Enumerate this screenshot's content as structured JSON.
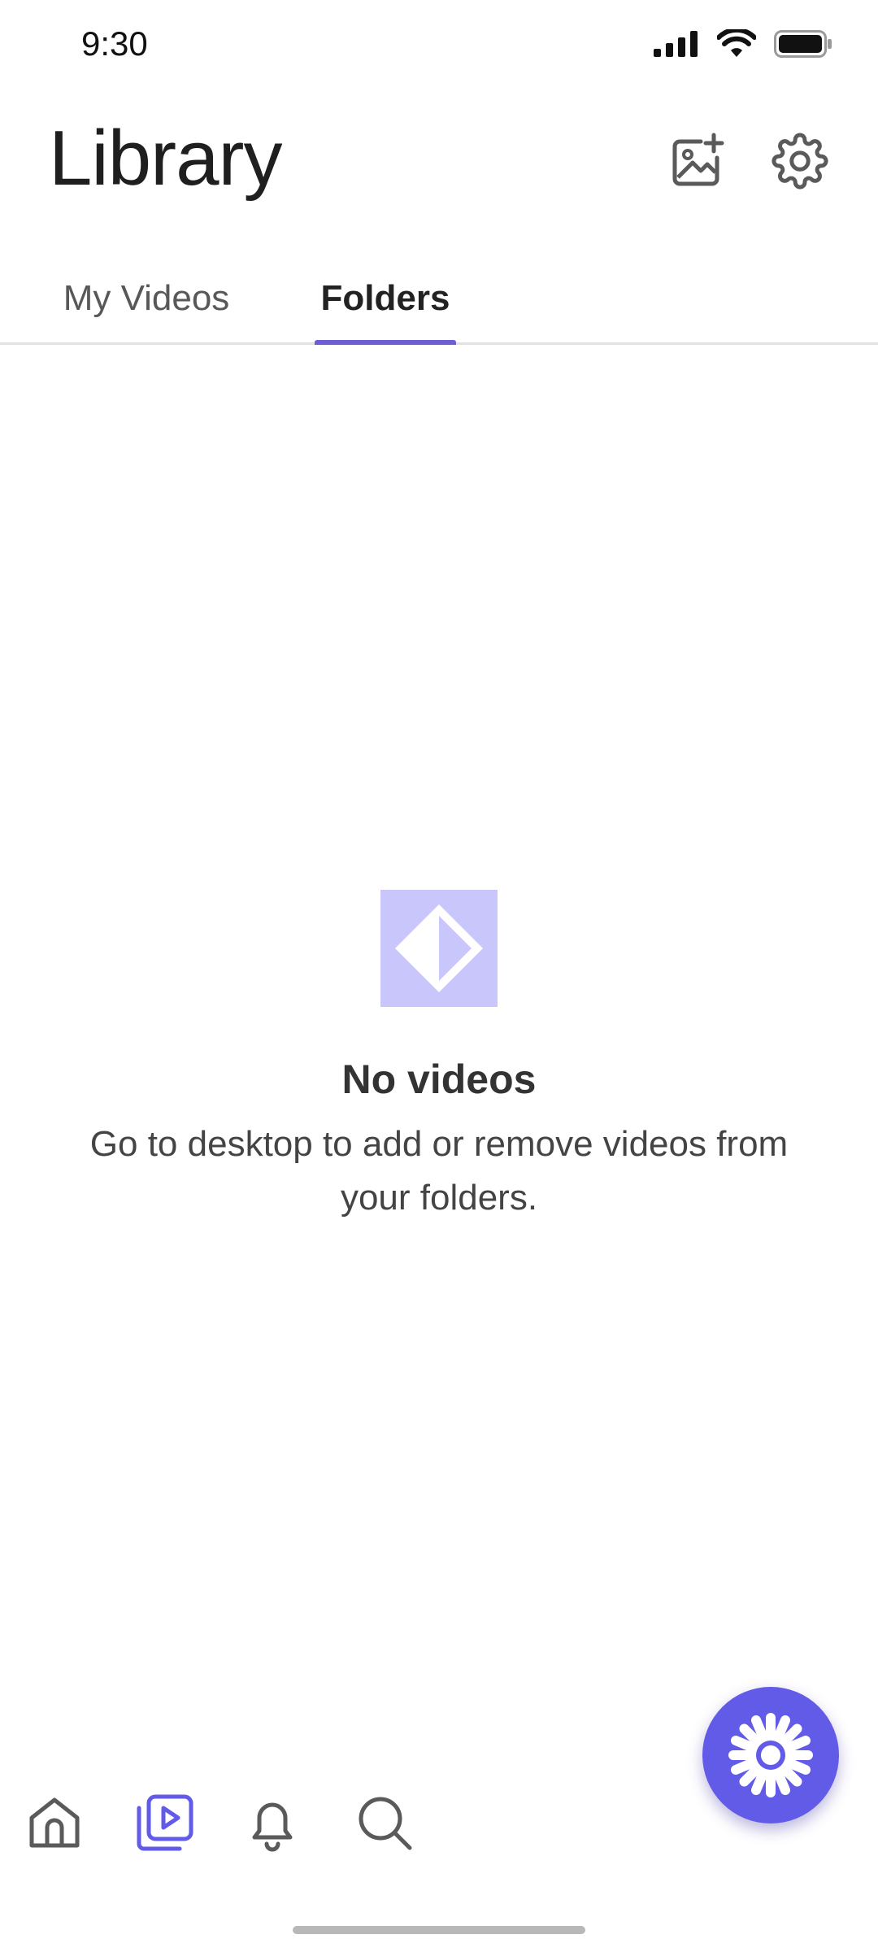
{
  "status_bar": {
    "time": "9:30"
  },
  "header": {
    "title": "Library"
  },
  "tabs": [
    {
      "label": "My Videos",
      "active": false
    },
    {
      "label": "Folders",
      "active": true
    }
  ],
  "empty_state": {
    "title": "No videos",
    "description": "Go to desktop to add or remove videos from your folders."
  },
  "icons": {
    "add_image": "add-image-icon",
    "settings": "gear-icon",
    "fab": "sparkle-icon",
    "nav_home": "home-icon",
    "nav_library": "video-library-icon",
    "nav_notifications": "bell-icon",
    "nav_search": "search-icon"
  },
  "colors": {
    "accent": "#6d5ed6",
    "fab": "#615be8",
    "empty_icon": "#c9c6fb",
    "inactive_icon": "#5a5a5a"
  }
}
